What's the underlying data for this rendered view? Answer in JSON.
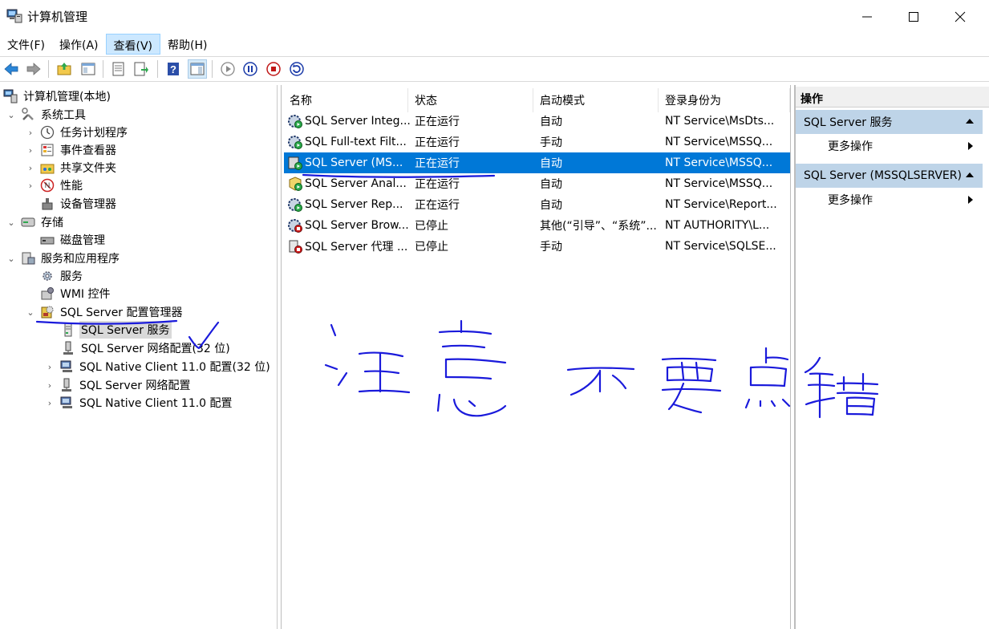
{
  "window": {
    "title": "计算机管理"
  },
  "menu": [
    "文件(F)",
    "操作(A)",
    "查看(V)",
    "帮助(H)"
  ],
  "tree": {
    "root": "计算机管理(本地)",
    "system_tools": "系统工具",
    "task_scheduler": "任务计划程序",
    "event_viewer": "事件查看器",
    "shared_folders": "共享文件夹",
    "performance": "性能",
    "device_manager": "设备管理器",
    "storage": "存储",
    "disk_management": "磁盘管理",
    "services_apps": "服务和应用程序",
    "services": "服务",
    "wmi": "WMI 控件",
    "sql_config_manager": "SQL Server 配置管理器",
    "sql_services": "SQL Server 服务",
    "sql_network_32": "SQL Server 网络配置(32 位)",
    "native_client_32": "SQL Native Client 11.0 配置(32 位)",
    "sql_network": "SQL Server 网络配置",
    "native_client": "SQL Native Client 11.0 配置"
  },
  "list": {
    "columns": [
      "名称",
      "状态",
      "启动模式",
      "登录身份为"
    ],
    "rows": [
      {
        "name": "SQL Server Integ...",
        "state": "正在运行",
        "mode": "自动",
        "logon": "NT Service\\MsDts..."
      },
      {
        "name": "SQL Full-text Filt...",
        "state": "正在运行",
        "mode": "手动",
        "logon": "NT Service\\MSSQ..."
      },
      {
        "name": "SQL Server (MS...",
        "state": "正在运行",
        "mode": "自动",
        "logon": "NT Service\\MSSQ..."
      },
      {
        "name": "SQL Server Anal...",
        "state": "正在运行",
        "mode": "自动",
        "logon": "NT Service\\MSSQ..."
      },
      {
        "name": "SQL Server Rep...",
        "state": "正在运行",
        "mode": "自动",
        "logon": "NT Service\\Report..."
      },
      {
        "name": "SQL Server Brow...",
        "state": "已停止",
        "mode": "其他(“引导”、“系统”...",
        "logon": "NT AUTHORITY\\L..."
      },
      {
        "name": "SQL Server 代理 ...",
        "state": "已停止",
        "mode": "手动",
        "logon": "NT Service\\SQLSE..."
      }
    ],
    "selected_row": 2
  },
  "actions": {
    "title": "操作",
    "section1": "SQL Server 服务",
    "section1_more": "更多操作",
    "section2": "SQL Server (MSSQLSERVER)",
    "section2_more": "更多操作"
  },
  "colors": {
    "selection": "#0078d7",
    "action_header": "#bed4e8",
    "annotation_ink": "#1a1adb"
  }
}
